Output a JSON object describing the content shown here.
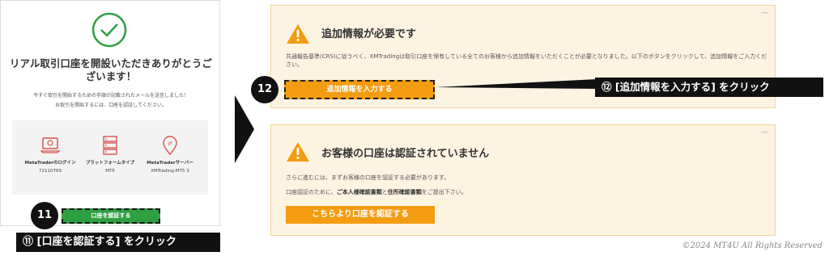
{
  "left": {
    "title": "リアル取引口座を開設いただきありがとうございます！",
    "desc1": "今すぐ取引を開始するための手順が記載されたメールを送信しました！",
    "desc2": "お取引を開始するには、口座を認証してください。",
    "col1_label": "MetaTraderのログイン",
    "col1_value": "72110789",
    "col2_label": "プラットフォームタイプ",
    "col2_value": "MT5",
    "col3_label": "MetaTraderサーバー",
    "col3_value": "XMTrading-MT5 3",
    "verify_button": "口座を認証する"
  },
  "right": {
    "alert1_title": "追加情報が必要です",
    "alert1_text": "共通報告基準(CRS)に従うべく、XMTradingは取引口座を保有している全てのお客様から追加情報をいただくことが必要となりました。以下のボタンをクリックして、追加情報をご入力ください。",
    "add_info_button": "追加情報を入力する",
    "alert2_title": "お客様の口座は認証されていません",
    "alert2_text1": "さらに進むには、まずお客様の口座を認証する必要があります。",
    "alert2_text2_a": "口座認証のために、",
    "alert2_text2_b": "ご本人様確認書類",
    "alert2_text2_c": "と",
    "alert2_text2_d": "住所確認書類",
    "alert2_text2_e": "をご提出下さい。",
    "verify_link_button": "こちらより口座を認証する",
    "collapse_symbol": "—"
  },
  "annotations": {
    "badge11": "11",
    "callout11": "⑪ [口座を認証する] をクリック",
    "badge12": "12",
    "callout12": "⑫ [追加情報を入力する] をクリック"
  },
  "copyright": "©2024 MT4U All Rights Reserved",
  "colors": {
    "green": "#2ea043",
    "orange": "#f39c12",
    "alert_bg": "#fdf3e1",
    "icon_red": "#d9534f"
  },
  "icons": [
    "check-circle-icon",
    "laptop-icon",
    "server-icon",
    "location-pin-icon",
    "warning-icon",
    "arrow-right-icon"
  ]
}
